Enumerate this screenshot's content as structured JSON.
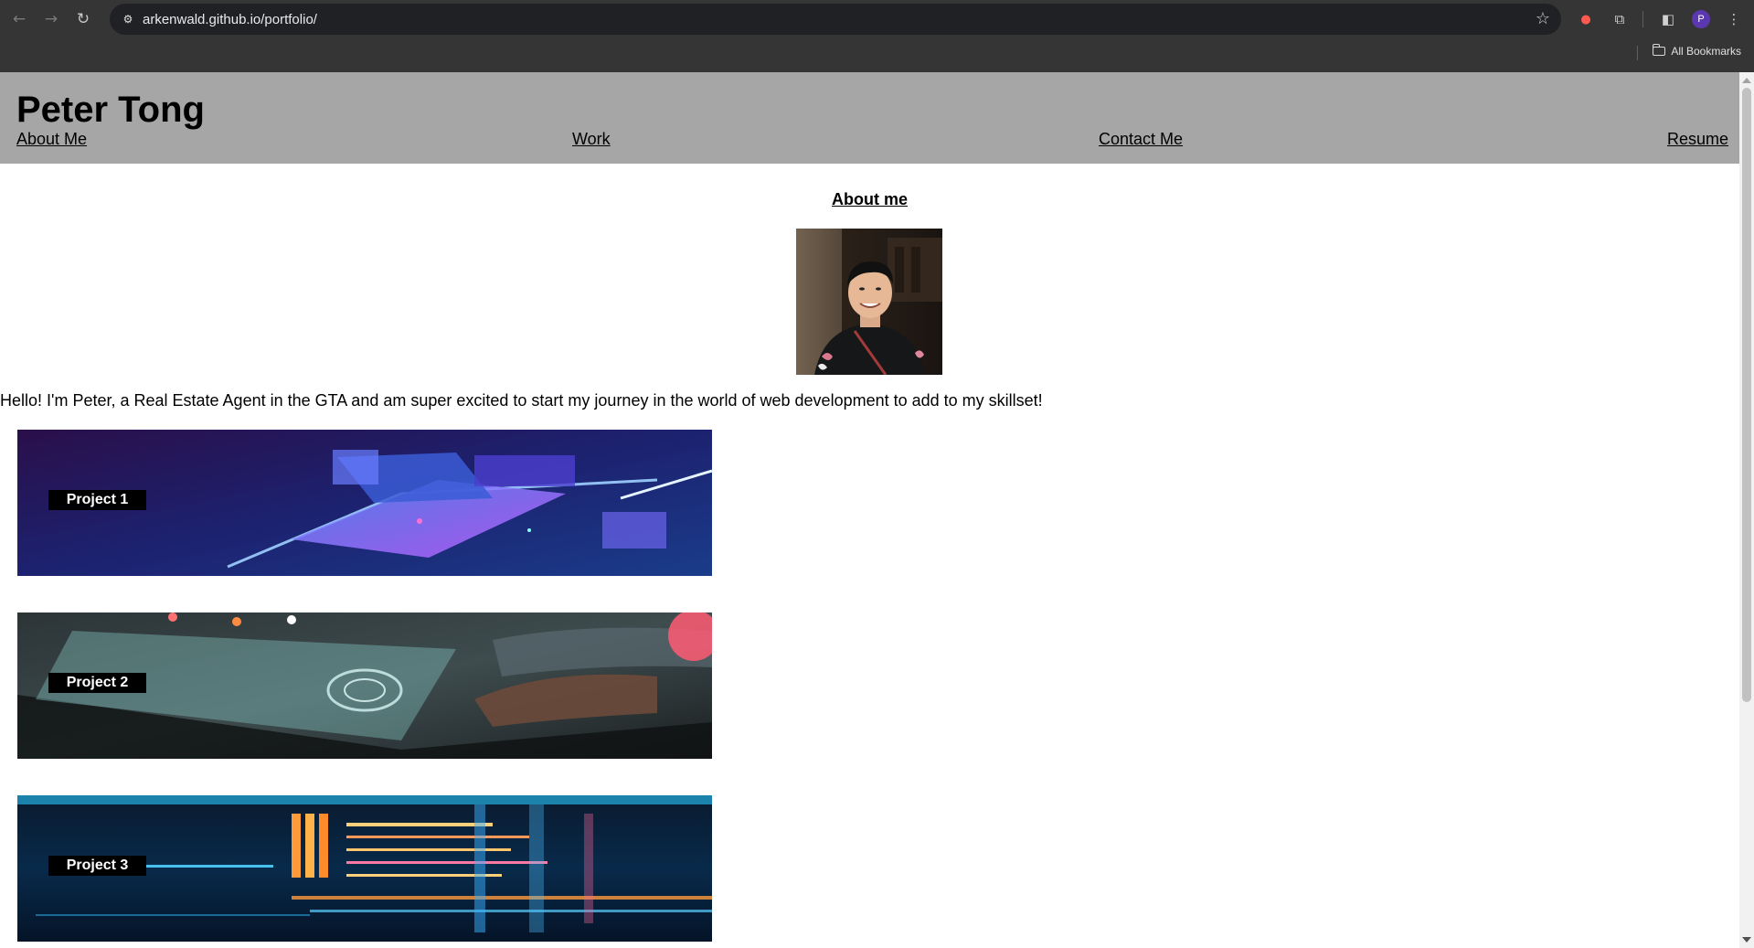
{
  "browser": {
    "url": "arkenwald.github.io/portfolio/",
    "bookmarks_label": "All Bookmarks",
    "profile_initial": "P",
    "back_glyph": "←",
    "forward_glyph": "→",
    "reload_glyph": "↻",
    "site_info_glyph": "⚙",
    "star_glyph": "☆",
    "extensions_glyph": "⧉",
    "sidepanel_glyph": "◧",
    "menu_glyph": "⋮",
    "ext_glyph": "●"
  },
  "site": {
    "title": "Peter Tong",
    "nav": [
      {
        "label": "About Me"
      },
      {
        "label": "Work"
      },
      {
        "label": "Contact Me"
      },
      {
        "label": "Resume"
      }
    ]
  },
  "about": {
    "heading": "About me",
    "intro": "Hello! I'm Peter, a Real Estate Agent in the GTA and am super excited to start my journey in the world of web development to add to my skillset!"
  },
  "projects": [
    {
      "label": "Project 1"
    },
    {
      "label": "Project 2"
    },
    {
      "label": "Project 3"
    }
  ],
  "colors": {
    "chrome": "#353535",
    "omnibox": "#202124",
    "header": "#a6a6a6",
    "label_bg": "#000000",
    "profile": "#5b38b0"
  }
}
